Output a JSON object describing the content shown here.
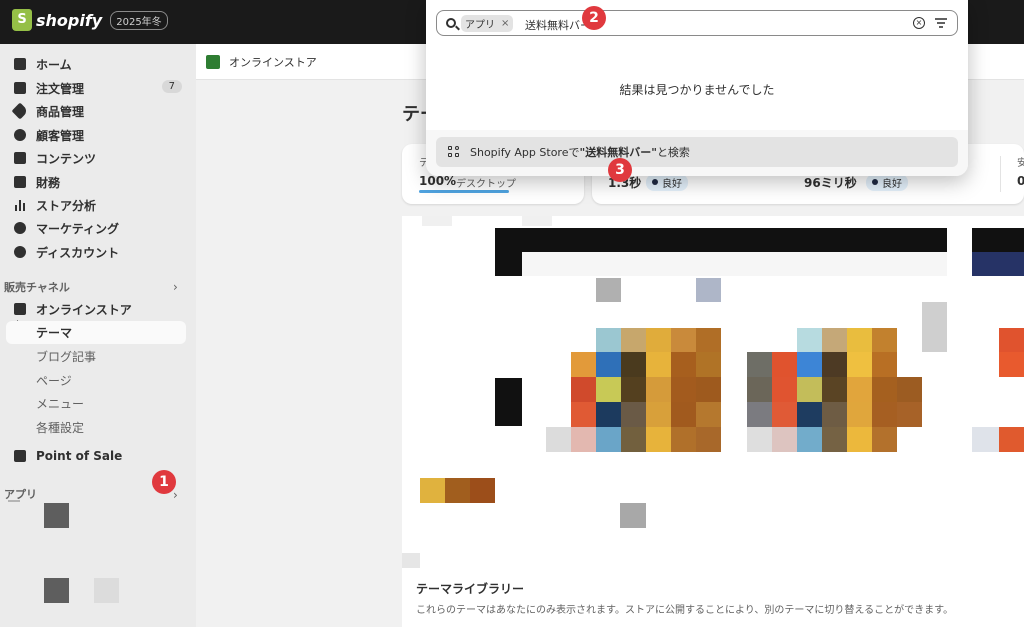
{
  "topbar": {
    "brand": "shopify",
    "edition": "2025年冬"
  },
  "sidebar": {
    "items": [
      {
        "label": "ホーム",
        "icon": "home-icon"
      },
      {
        "label": "注文管理",
        "icon": "inbox-icon",
        "badge": "7"
      },
      {
        "label": "商品管理",
        "icon": "tag-icon"
      },
      {
        "label": "顧客管理",
        "icon": "person-icon"
      },
      {
        "label": "コンテンツ",
        "icon": "content-icon"
      },
      {
        "label": "財務",
        "icon": "bank-icon"
      },
      {
        "label": "ストア分析",
        "icon": "bar-chart-icon"
      },
      {
        "label": "マーケティング",
        "icon": "target-icon"
      },
      {
        "label": "ディスカウント",
        "icon": "discount-icon"
      }
    ],
    "sales_channels_label": "販売チャネル",
    "online_store_label": "オンラインストア",
    "sub_items": [
      "テーマ",
      "ブログ記事",
      "ページ",
      "メニュー",
      "各種設定"
    ],
    "pos_label": "Point of Sale",
    "apps_label": "アプリ"
  },
  "steps": [
    "1",
    "2",
    "3"
  ],
  "header": {
    "title": "オンラインストア"
  },
  "page": {
    "title": "テーマ",
    "metric1_prefix": "テ",
    "metric1_value": "100%",
    "metric1_note": "デスクトップ",
    "metric2_value": "1.3秒",
    "metric2_status": "良好",
    "metric3_value": "96ミリ秒",
    "metric3_status": "良好",
    "metric4_prefix": "安",
    "metric4_value": "0"
  },
  "library": {
    "title": "テーマライブラリー",
    "description": "これらのテーマはあなたにのみ表示されます。ストアに公開することにより、別のテーマに切り替えることができます。"
  },
  "search": {
    "chip_label": "アプリ",
    "chip_close": "×",
    "query": "送料無料バー",
    "no_results": "結果は見つかりませんでした",
    "appstore_prefix": "Shopify App Storeで",
    "appstore_term": "\"送料無料バー\"",
    "appstore_suffix": "と検索"
  },
  "colors": {
    "topbar": "#1a1a1a",
    "sidebar": "#ebebeb",
    "step_badge": "#e0393e",
    "brand_green": "#95bf47"
  }
}
